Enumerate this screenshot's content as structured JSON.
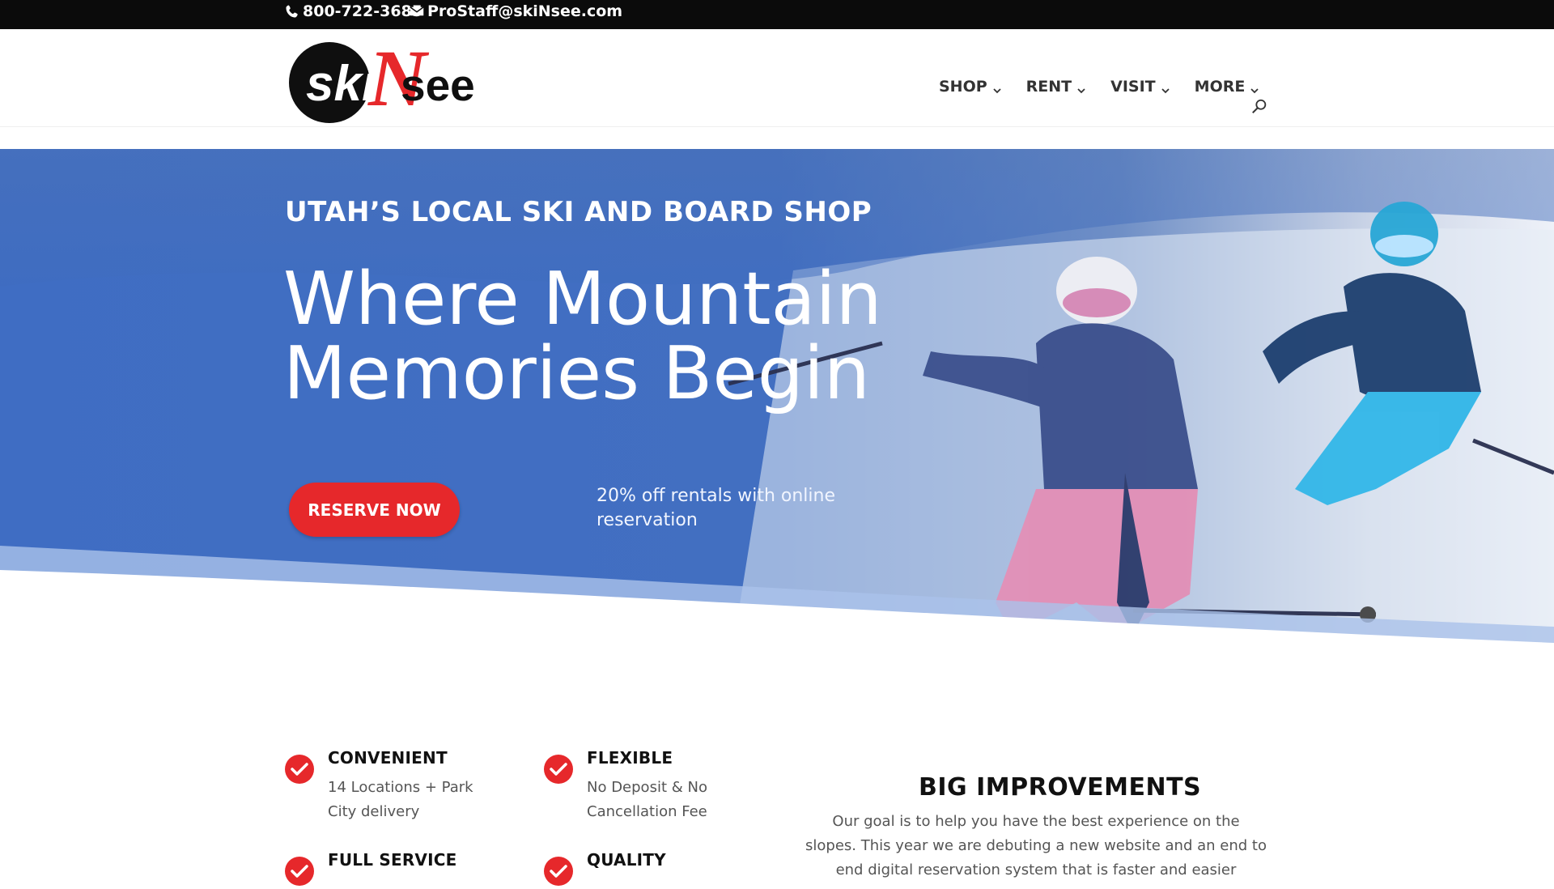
{
  "topbar": {
    "phone": "800-722-3685",
    "email": "ProStaff@skiNsee.com",
    "phone_icon": "phone-icon",
    "email_icon": "mail-icon"
  },
  "header": {
    "logo_text_1": "ski",
    "logo_text_2": "N",
    "logo_text_3": "see",
    "nav": [
      {
        "label": "SHOP"
      },
      {
        "label": "RENT"
      },
      {
        "label": "VISIT"
      },
      {
        "label": "MORE"
      }
    ],
    "search_icon": "search-icon"
  },
  "hero": {
    "kicker": "UTAH’S LOCAL SKI AND BOARD SHOP",
    "headline_line1": "Where Mountain",
    "headline_line2": "Memories Begin",
    "cta": "RESERVE NOW",
    "promo": "20% off rentals with online reservation"
  },
  "features": [
    {
      "title": "CONVENIENT",
      "desc": "14 Locations + Park City delivery"
    },
    {
      "title": "FLEXIBLE",
      "desc": "No Deposit & No Cancellation Fee"
    },
    {
      "title": "FULL SERVICE",
      "desc": ""
    },
    {
      "title": "QUALITY",
      "desc": ""
    }
  ],
  "improvements": {
    "title": "BIG IMPROVEMENTS",
    "text": "Our goal is to help you have the best experience on the slopes. This year we are debuting a new website and an end to end digital reservation system that is faster and easier"
  },
  "colors": {
    "accent_red": "#e6282b",
    "hero_blue": "#3f6cbf",
    "topbar": "#0b0b0b"
  }
}
